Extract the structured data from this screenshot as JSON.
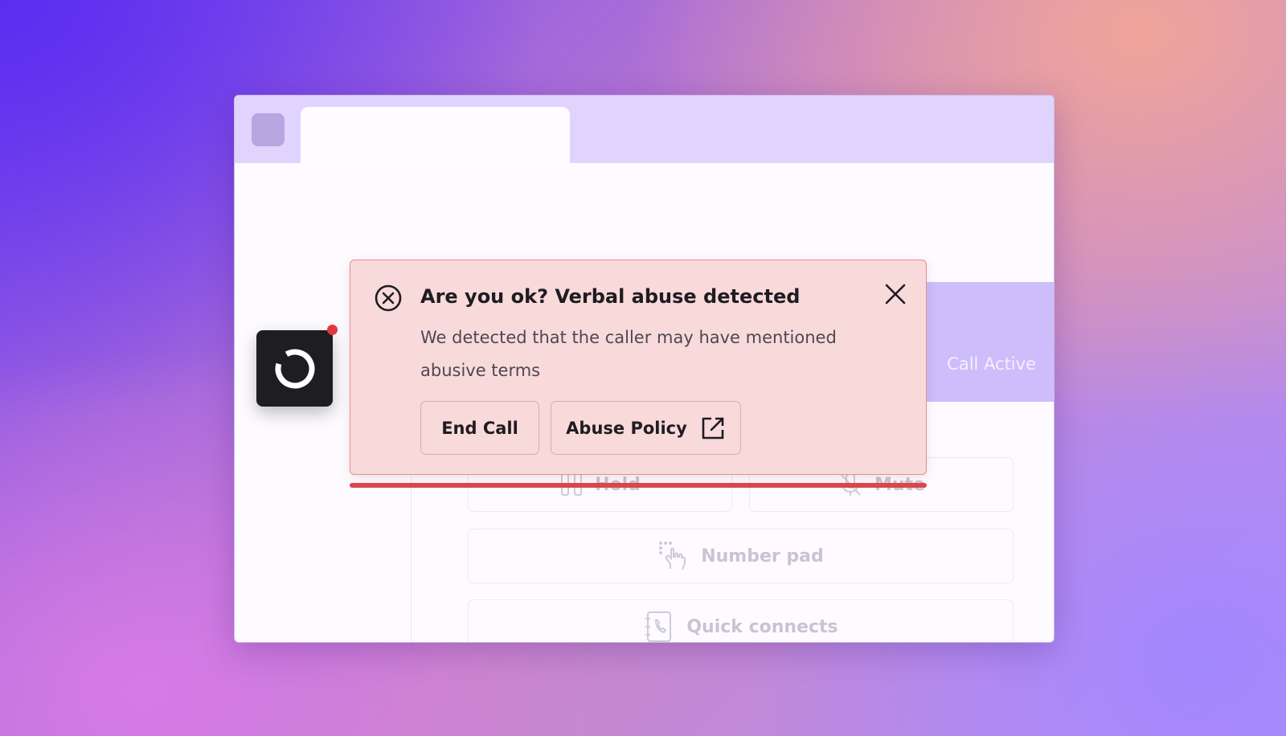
{
  "status": {
    "call_state": "Call Active"
  },
  "controls": {
    "hold_label": "Hold",
    "mute_label": "Mute",
    "number_pad_label": "Number pad",
    "quick_connects_label": "Quick connects"
  },
  "alert": {
    "title": "Are you ok? Verbal abuse detected",
    "body": "We detected that the caller may have mentioned abusive terms",
    "end_call_label": "End Call",
    "abuse_policy_label": "Abuse Policy"
  },
  "colors": {
    "alert_background": "#f8dada",
    "alert_border": "#e88d8f",
    "progress_bar": "#d9474b",
    "status_bar": "#cdbdfb",
    "notification_badge": "#e0383e",
    "app_icon_background": "#1d1d22"
  },
  "icons": {
    "alert": "circle-x-icon",
    "close": "close-icon",
    "external_link": "external-link-icon",
    "app": "ring-logo-icon",
    "hold": "pause-icon",
    "mute": "mic-off-icon",
    "number_pad": "tap-hand-icon",
    "quick_connects": "phone-book-icon"
  }
}
